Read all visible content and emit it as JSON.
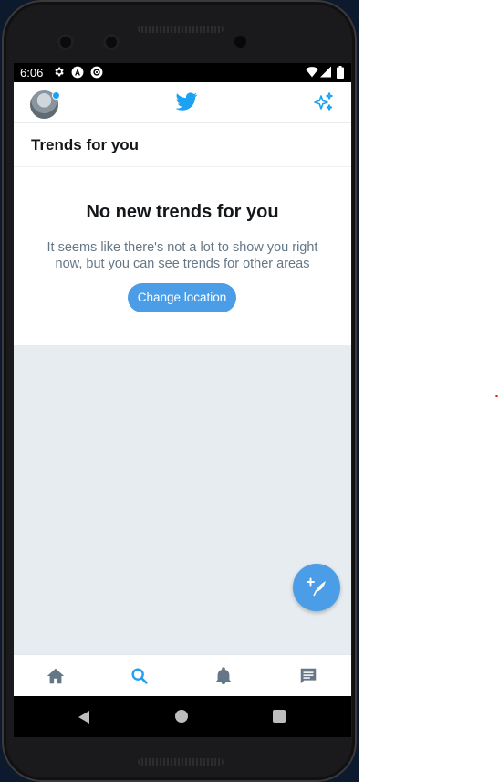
{
  "status_bar": {
    "time": "6:06",
    "left_icons": [
      "gear-icon",
      "a-icon",
      "sync-icon"
    ],
    "right_icons": [
      "wifi-icon",
      "signal-icon",
      "battery-icon"
    ]
  },
  "app_bar": {
    "avatar": "profile-avatar",
    "logo": "twitter-bird-icon",
    "action": "sparkle-icon"
  },
  "trends": {
    "title": "Trends for you"
  },
  "empty_state": {
    "title": "No new trends for you",
    "message": "It seems like there's not a lot to show you right now, but you can see trends for other areas",
    "button_label": "Change location"
  },
  "fab": {
    "icon": "compose-tweet-icon"
  },
  "bottom_nav": {
    "items": [
      {
        "icon": "home-icon",
        "active": false
      },
      {
        "icon": "search-icon",
        "active": true
      },
      {
        "icon": "bell-icon",
        "active": false
      },
      {
        "icon": "messages-icon",
        "active": false
      }
    ]
  },
  "system_nav": [
    "back-button",
    "home-button",
    "recents-button"
  ],
  "colors": {
    "accent": "#1da1f2",
    "button": "#4a9de6",
    "background": "#e6ecf0",
    "text_primary": "#14171a",
    "text_secondary": "#657786"
  }
}
